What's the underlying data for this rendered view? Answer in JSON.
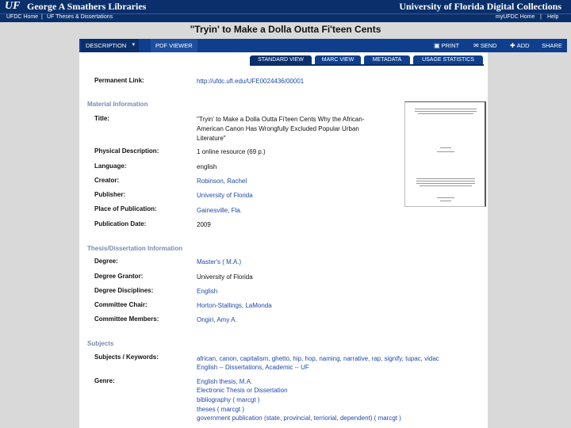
{
  "header": {
    "logo": "UF",
    "library_name": "George A Smathers Libraries",
    "collection_name": "University of Florida Digital Collections",
    "links_left": [
      "UFDC Home",
      "|",
      "UF Theses & Dissertations"
    ],
    "links_right": [
      "myUFDC Home",
      "|",
      "Help"
    ]
  },
  "title": "\"Tryin' to Make a Dolla Outta Fi'teen Cents",
  "nav": {
    "description": "DESCRIPTION",
    "pdf_viewer": "PDF VIEWER",
    "print": "PRINT",
    "send": "SEND",
    "add": "ADD",
    "share": "SHARE"
  },
  "view_tabs": [
    "STANDARD VIEW",
    "MARC VIEW",
    "METADATA",
    "USAGE STATISTICS"
  ],
  "permanent_link": {
    "label": "Permanent Link:",
    "value": "http://ufdc.ufl.edu/UFE0024436/00001"
  },
  "sections": {
    "material": "Material Information",
    "thesis": "Thesis/Dissertation Information",
    "subjects": "Subjects"
  },
  "material": {
    "title_label": "Title:",
    "title_value": [
      "\"Tryin' to Make a Dolla Outta Fi'teen Cents Why the African-",
      "American Canon Has Wrongfully Excluded Popular Urban",
      "Literature\""
    ],
    "physical_label": "Physical Description:",
    "physical_value": "1 online resource (69 p.)",
    "language_label": "Language:",
    "language_value": "english",
    "creator_label": "Creator:",
    "creator_value": "Robinson, Rachel",
    "publisher_label": "Publisher:",
    "publisher_value": "University of Florida",
    "place_label": "Place of Publication:",
    "place_value": "Gainesville, Fla.",
    "date_label": "Publication Date:",
    "date_value": "2009"
  },
  "thesis": {
    "degree_label": "Degree:",
    "degree_value": "Master's ( M.A.)",
    "grantor_label": "Degree Grantor:",
    "grantor_value": "University of Florida",
    "disciplines_label": "Degree Disciplines:",
    "disciplines_value": "English",
    "chair_label": "Committee Chair:",
    "chair_value": "Horton-Stallings, LaMonda",
    "members_label": "Committee Members:",
    "members_value": "Ongiri, Amy A."
  },
  "subjects": {
    "keywords_label": "Subjects / Keywords:",
    "keywords_value": [
      "african, canon, capitalism, ghetto, hip, hop, naming, narrative, rap, signify, tupac, vidac",
      "English -- Dissertations, Academic -- UF"
    ],
    "genre_label": "Genre:",
    "genre_value": [
      "English thesis, M.A.",
      "Electronic Thesis or Dissertation",
      "bibliography    ( marcgt )",
      "theses    ( marcgt )",
      "government publication (state, provincial, terriorial, dependent)    ( marcgt )"
    ]
  }
}
